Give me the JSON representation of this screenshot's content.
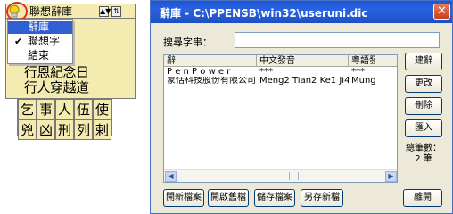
{
  "ime_panel": {
    "bar_title": "聯想辭庫",
    "menu": [
      {
        "label": "辭庫",
        "selected": true,
        "checked": false
      },
      {
        "label": "聯想字",
        "selected": false,
        "checked": true
      },
      {
        "label": "結束",
        "selected": false,
        "checked": false
      }
    ],
    "candidate_lines": [
      "行恩紀念日",
      "行人穿越道"
    ],
    "char_grid": [
      "乞",
      "事",
      "人",
      "伍",
      "使",
      "兇",
      "凶",
      "刑",
      "列",
      "剌"
    ]
  },
  "dialog": {
    "title": "辭庫 - C:\\PPENSB\\win32\\useruni.dic",
    "close_symbol": "✕",
    "search_label": "搜尋字串：",
    "search_value": "",
    "columns": [
      "辭",
      "中文發音",
      "粵語發"
    ],
    "rows": [
      [
        "P e n P o w e r",
        "***",
        "***"
      ],
      [
        "蒙恬科技股份有限公司",
        "Meng2 Tian2 Ke1 Ji4 Gu3 ...",
        "Mung"
      ]
    ],
    "side_buttons": {
      "create": "建辭",
      "modify": "更改",
      "delete": "刪除",
      "import": "匯入"
    },
    "word_count_label": "總筆數：",
    "word_count_value": "2 筆",
    "bottom_buttons": {
      "new": "開新檔案",
      "open": "開啟舊檔",
      "save": "儲存檔案",
      "save_as": "另存新檔",
      "close": "離開"
    }
  }
}
